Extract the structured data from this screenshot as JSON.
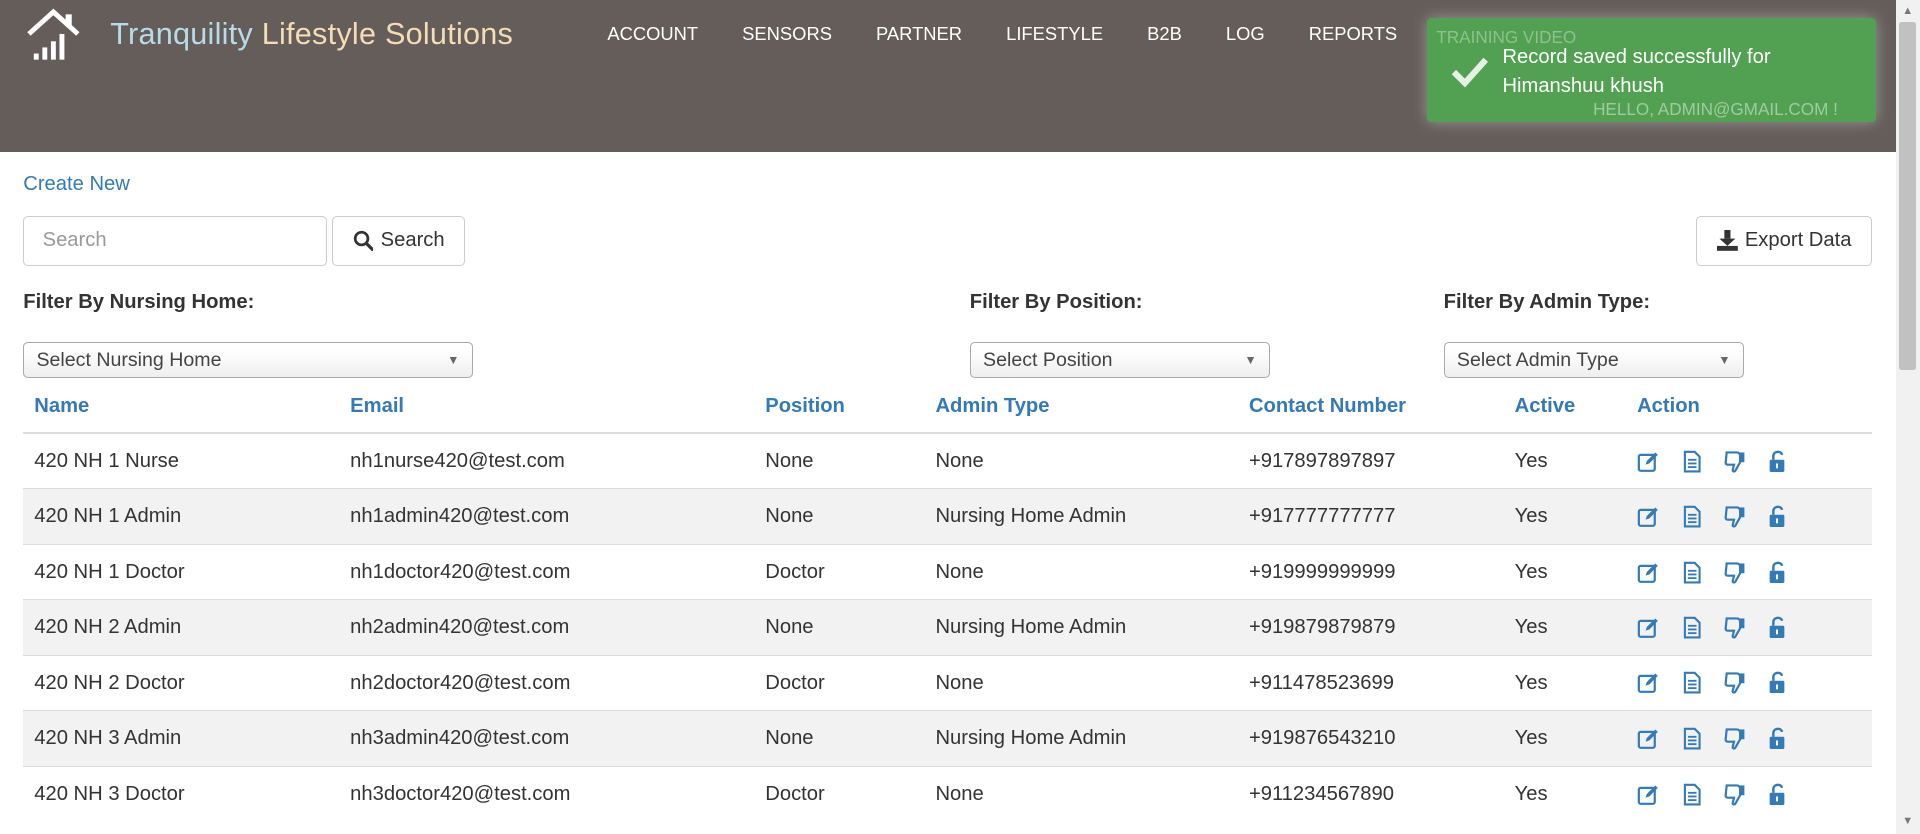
{
  "brand": {
    "part1": "Tranquility",
    "part2": "Lifestyle Solutions"
  },
  "nav": [
    "ACCOUNT",
    "SENSORS",
    "PARTNER",
    "LIFESTYLE",
    "B2B",
    "LOG",
    "REPORTS"
  ],
  "nav_right": {
    "training": "TRAINING VIDEO",
    "hello": "HELLO, ADMIN@GMAIL.COM !"
  },
  "toast": {
    "message": "Record saved successfully for Himanshuu khush"
  },
  "create_new": "Create New",
  "search": {
    "placeholder": "Search",
    "button": "Search"
  },
  "export_button": "Export Data",
  "filters": {
    "nursing_home": {
      "label": "Filter By Nursing Home:",
      "selected": "Select Nursing Home"
    },
    "position": {
      "label": "Filter By Position:",
      "selected": "Select Position"
    },
    "admin_type": {
      "label": "Filter By Admin Type:",
      "selected": "Select Admin Type"
    }
  },
  "table": {
    "headers": [
      "Name",
      "Email",
      "Position",
      "Admin Type",
      "Contact Number",
      "Active",
      "Action"
    ],
    "rows": [
      [
        "420 NH 1 Nurse",
        "nh1nurse420@test.com",
        "None",
        "None",
        "+917897897897",
        "Yes"
      ],
      [
        "420 NH 1 Admin",
        "nh1admin420@test.com",
        "None",
        "Nursing Home Admin",
        "+917777777777",
        "Yes"
      ],
      [
        "420 NH 1 Doctor",
        "nh1doctor420@test.com",
        "Doctor",
        "None",
        "+919999999999",
        "Yes"
      ],
      [
        "420 NH 2 Admin",
        "nh2admin420@test.com",
        "None",
        "Nursing Home Admin",
        "+919879879879",
        "Yes"
      ],
      [
        "420 NH 2 Doctor",
        "nh2doctor420@test.com",
        "Doctor",
        "None",
        "+911478523699",
        "Yes"
      ],
      [
        "420 NH 3 Admin",
        "nh3admin420@test.com",
        "None",
        "Nursing Home Admin",
        "+919876543210",
        "Yes"
      ],
      [
        "420 NH 3 Doctor",
        "nh3doctor420@test.com",
        "Doctor",
        "None",
        "+911234567890",
        "Yes"
      ]
    ],
    "action_icons": [
      "edit-icon",
      "details-icon",
      "thumbs-down-icon",
      "unlock-icon"
    ]
  },
  "colors": {
    "navbar": "#645d59",
    "link": "#337ab7",
    "toast": "#51a351"
  }
}
